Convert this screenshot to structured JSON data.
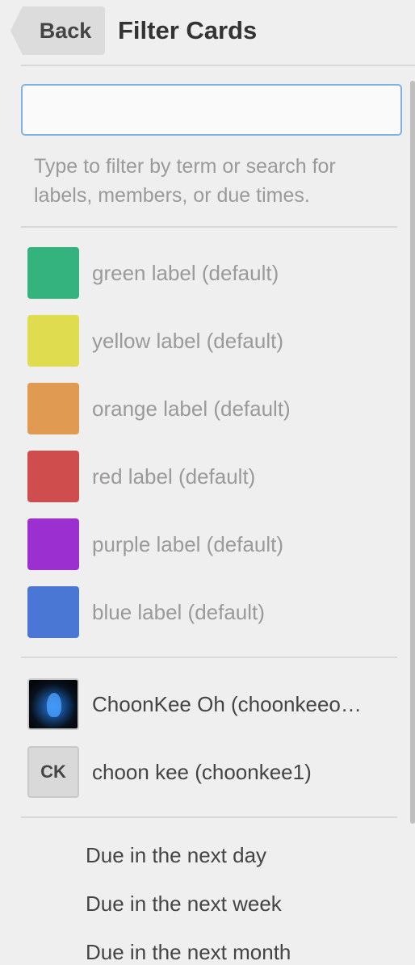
{
  "header": {
    "back_label": "Back",
    "title": "Filter Cards"
  },
  "search": {
    "value": "",
    "placeholder": ""
  },
  "hint": "Type to filter by term or search for labels, members, or due times.",
  "labels": [
    {
      "name": "green label (default)",
      "color": "#34b37e"
    },
    {
      "name": "yellow label (default)",
      "color": "#dfdc4f"
    },
    {
      "name": "orange label (default)",
      "color": "#e09a52"
    },
    {
      "name": "red label (default)",
      "color": "#cf4d4d"
    },
    {
      "name": "purple label (default)",
      "color": "#9b2fcf"
    },
    {
      "name": "blue label (default)",
      "color": "#4a76d4"
    }
  ],
  "members": [
    {
      "name": "ChoonKee Oh (choonkeeo…",
      "avatar": "photo"
    },
    {
      "name": "choon kee (choonkee1)",
      "initials": "CK"
    }
  ],
  "due": [
    "Due in the next day",
    "Due in the next week",
    "Due in the next month"
  ]
}
